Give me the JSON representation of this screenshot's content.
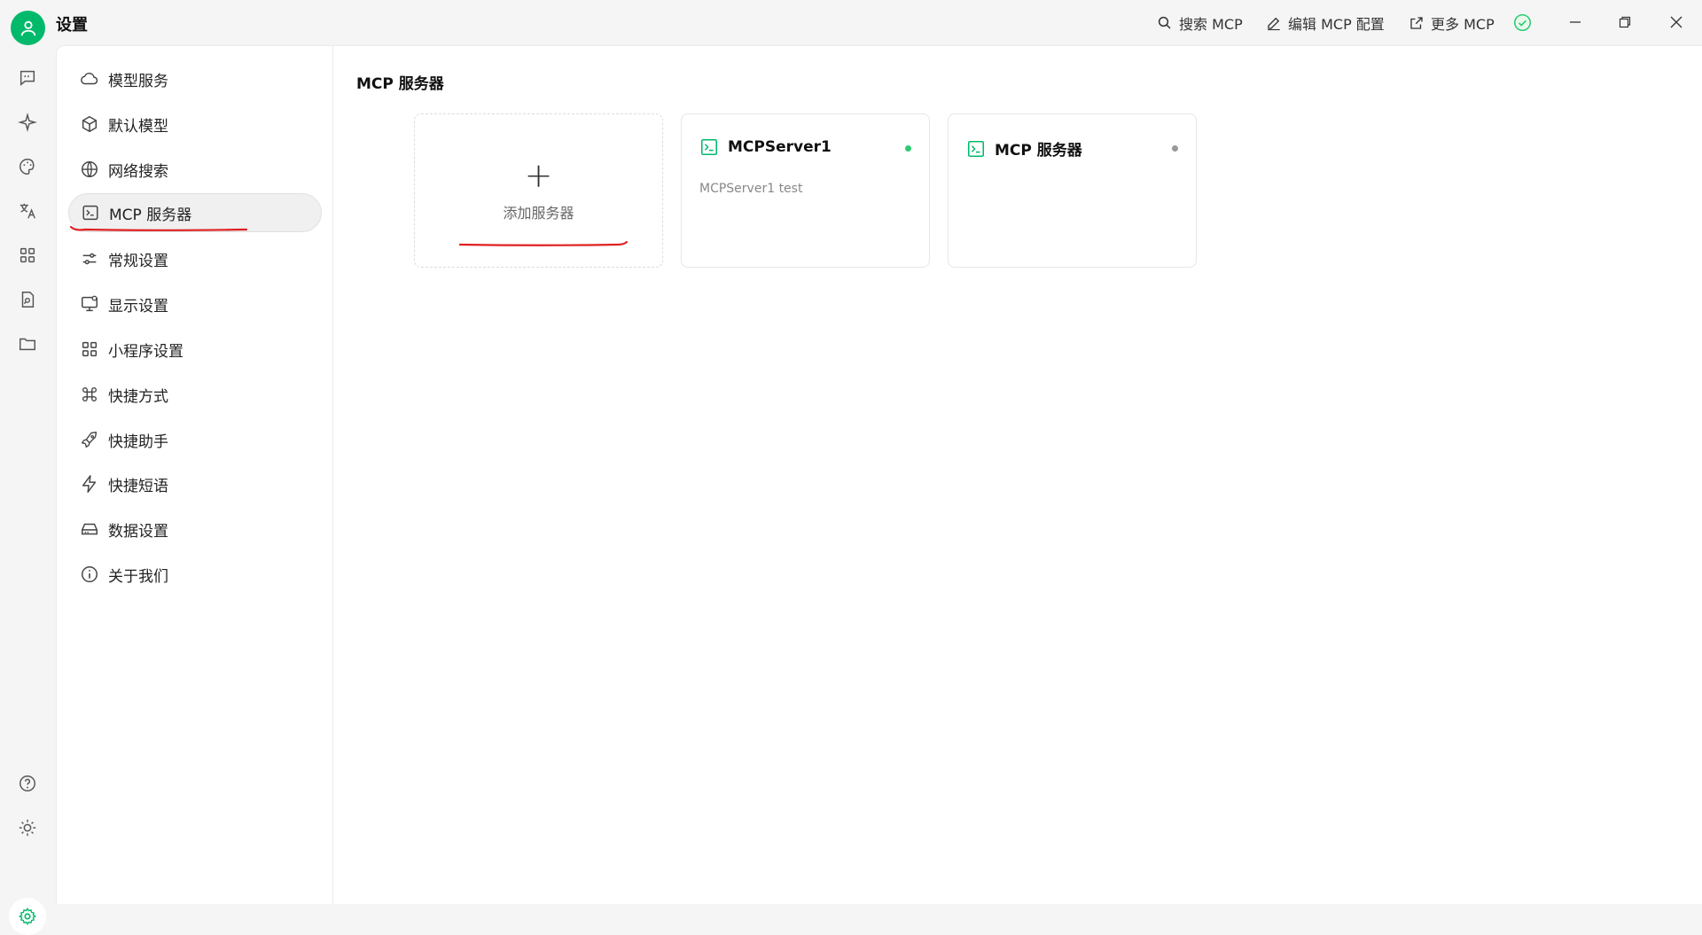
{
  "app": {
    "title": "设置"
  },
  "toolbar": {
    "search_label": "搜索 MCP",
    "edit_label": "编辑 MCP 配置",
    "more_label": "更多 MCP"
  },
  "colors": {
    "accent": "#00b96b",
    "active_dot": "#2ecc71",
    "inactive_dot": "#999999",
    "annotation": "#e02020"
  },
  "settings_menu": {
    "items": [
      {
        "label": "模型服务",
        "icon": "cloud-icon"
      },
      {
        "label": "默认模型",
        "icon": "cube-icon"
      },
      {
        "label": "网络搜索",
        "icon": "globe-icon"
      },
      {
        "label": "MCP 服务器",
        "icon": "terminal-icon",
        "active": true
      },
      {
        "label": "常规设置",
        "icon": "sliders-icon"
      },
      {
        "label": "显示设置",
        "icon": "monitor-icon"
      },
      {
        "label": "小程序设置",
        "icon": "grid-icon"
      },
      {
        "label": "快捷方式",
        "icon": "command-icon"
      },
      {
        "label": "快捷助手",
        "icon": "rocket-icon"
      },
      {
        "label": "快捷短语",
        "icon": "zap-icon"
      },
      {
        "label": "数据设置",
        "icon": "hard-drive-icon"
      },
      {
        "label": "关于我们",
        "icon": "info-icon"
      }
    ]
  },
  "main": {
    "title": "MCP 服务器",
    "add_card": {
      "label": "添加服务器",
      "plus": "+"
    },
    "servers": [
      {
        "name": "MCPServer1",
        "description": "MCPServer1 test",
        "status": "active"
      },
      {
        "name": "MCP 服务器",
        "description": "",
        "status": "inactive"
      }
    ]
  }
}
